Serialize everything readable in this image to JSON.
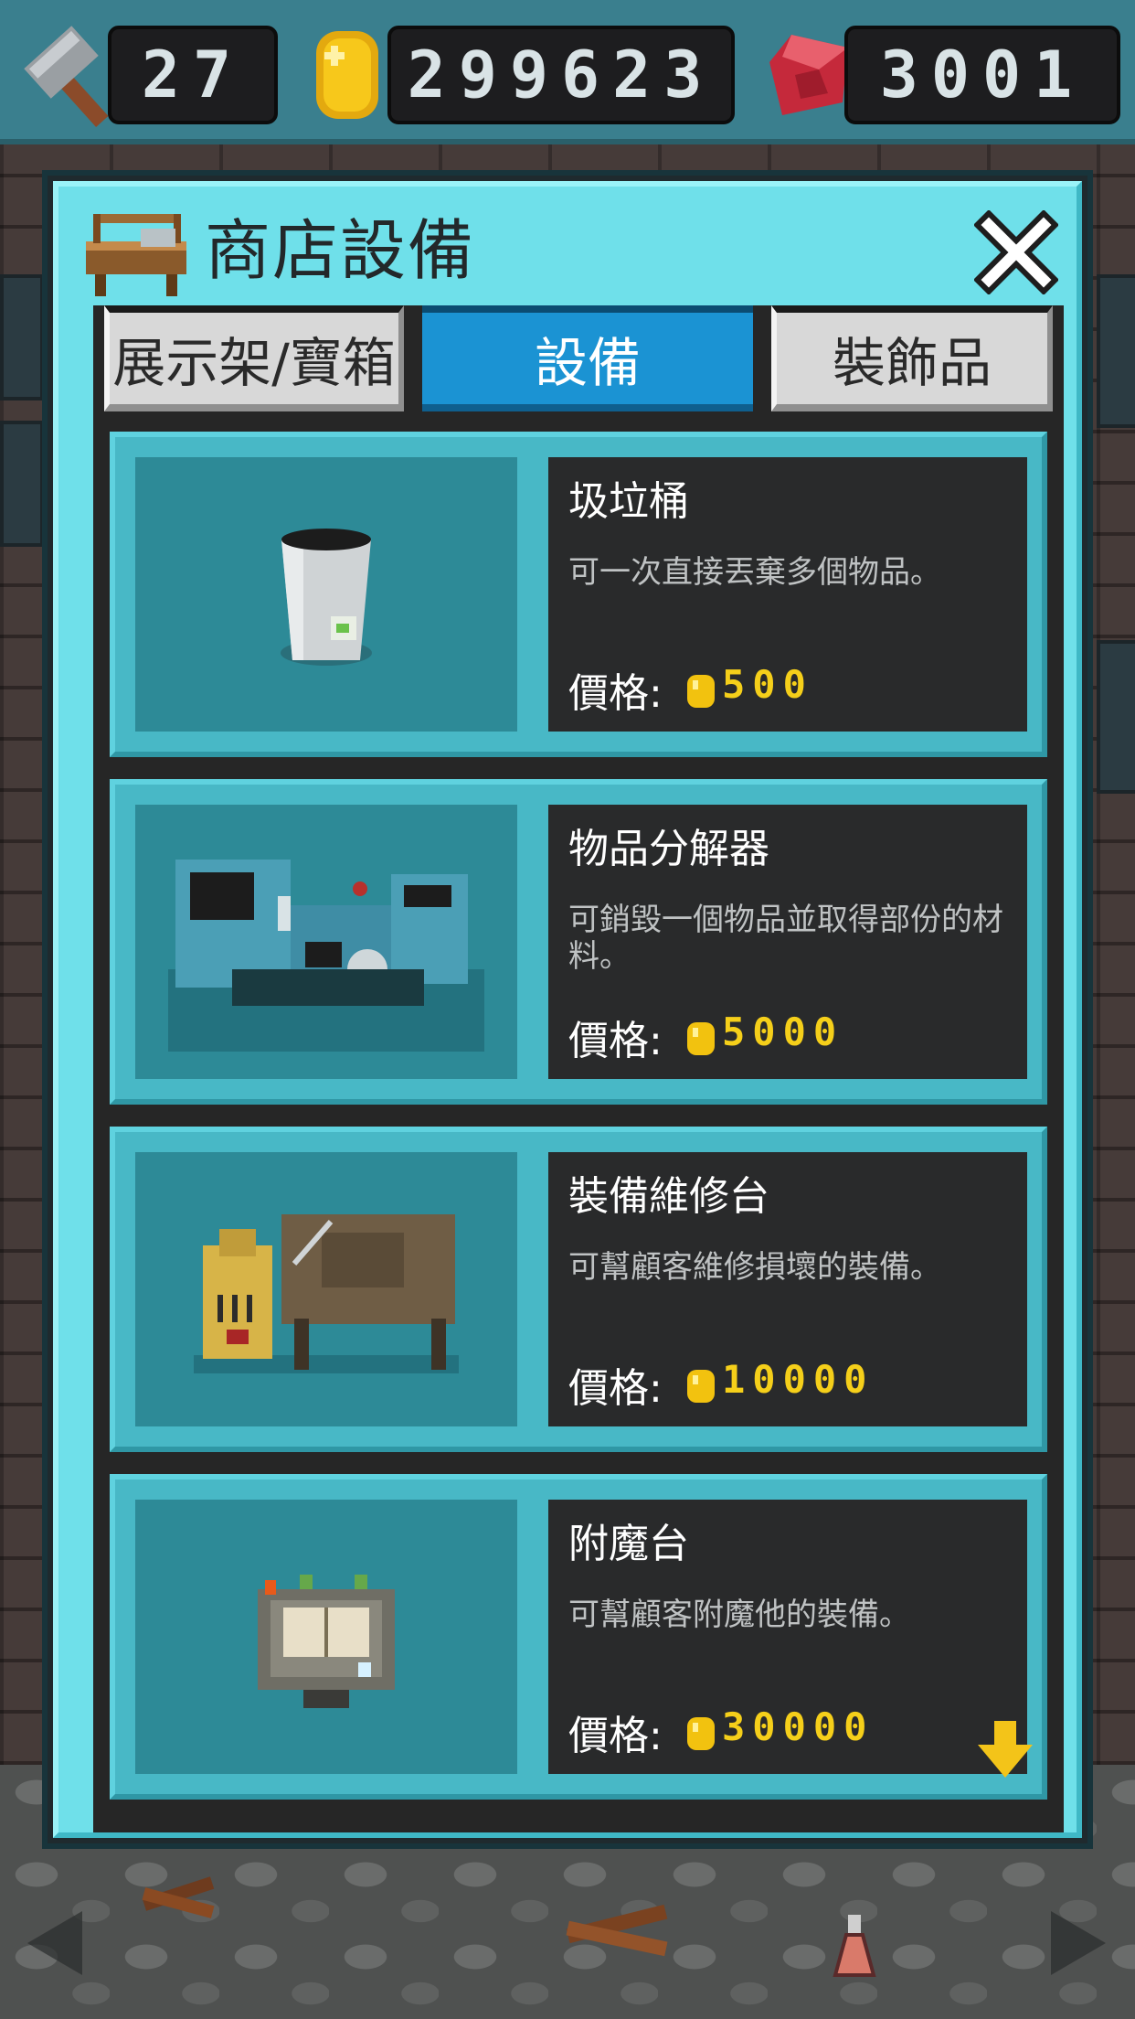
{
  "resources": {
    "hammer_count": "27",
    "gold": "299623",
    "gems": "3001"
  },
  "panel": {
    "title": "商店設備",
    "tabs": [
      {
        "label": "展示架/寶箱",
        "active": false
      },
      {
        "label": "設備",
        "active": true
      },
      {
        "label": "裝飾品",
        "active": false
      }
    ],
    "price_label": "價格:",
    "items": [
      {
        "name": "圾垃桶",
        "description": "可一次直接丟棄多個物品。",
        "price": "500",
        "icon": "trash-can-icon"
      },
      {
        "name": "物品分解器",
        "description": "可銷毀一個物品並取得部份的材料。",
        "price": "5000",
        "icon": "item-disassembler-icon"
      },
      {
        "name": "裝備維修台",
        "description": "可幫顧客維修損壞的裝備。",
        "price": "10000",
        "icon": "repair-bench-icon"
      },
      {
        "name": "附魔台",
        "description": "可幫顧客附魔他的裝備。",
        "price": "30000",
        "icon": "enchanting-table-icon"
      }
    ]
  },
  "colors": {
    "panel_bg": "#6fe0ea",
    "active_tab": "#1b93d3",
    "price_gold": "#f5cf1a"
  }
}
